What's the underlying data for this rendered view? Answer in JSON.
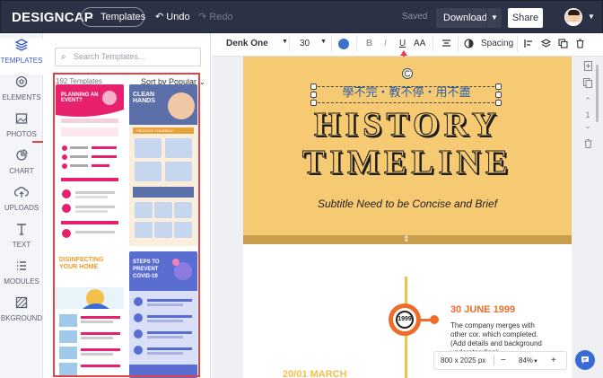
{
  "topbar": {
    "logo_design": "DESIGN",
    "logo_cap": "CAP",
    "templates_label": "Templates",
    "undo_label": "Undo",
    "redo_label": "Redo",
    "saved_label": "Saved",
    "download_label": "Download",
    "share_label": "Share"
  },
  "sidebar": {
    "items": [
      {
        "label": "TEMPLATES",
        "icon": "layers-icon"
      },
      {
        "label": "ELEMENTS",
        "icon": "elements-icon"
      },
      {
        "label": "PHOTOS",
        "icon": "photo-icon"
      },
      {
        "label": "CHART",
        "icon": "pie-chart-icon"
      },
      {
        "label": "UPLOADS",
        "icon": "upload-icon"
      },
      {
        "label": "TEXT",
        "icon": "text-icon"
      },
      {
        "label": "MODULES",
        "icon": "modules-icon"
      },
      {
        "label": "BKGROUND",
        "icon": "background-icon"
      }
    ]
  },
  "panel": {
    "search_placeholder": "Search Templates...",
    "count": "192 Templates",
    "sort_label": "Sort by Popular",
    "thumbs": [
      {
        "title": "PLANNING AN EVENT?"
      },
      {
        "title": "CLEAN HANDS",
        "sub": "PROTECT YOURSELF"
      },
      {
        "title": "DISINFECTING YOUR HOME"
      },
      {
        "title": "STEPS TO PREVENT COVID-19"
      }
    ]
  },
  "toolbar": {
    "font_name": "Denk One",
    "font_size": "30",
    "text_color": "#3b71c8",
    "bold": "B",
    "italic": "I",
    "underline": "U",
    "case": "AA",
    "spacing_label": "Spacing"
  },
  "canvas": {
    "chinese_text": "學不完・教不停・用不盡",
    "title_line1": "HISTORY",
    "title_line2": "TIMELINE",
    "subtitle": "Subtitle  Need to be Concise and Brief",
    "timeline_year": "1999",
    "timeline_date": "30 JUNE 1999",
    "timeline_desc": "The company merges with other cor. which completed. (Add details and background understanding)",
    "timeline_date2": "20/01 MARCH"
  },
  "rail": {
    "page_number": "1"
  },
  "zoom": {
    "size": "800 x 2025 px",
    "percent": "84%"
  },
  "colors": {
    "topbar": "#2c3245",
    "accent": "#3a57c5",
    "header_yellow": "#f6ca73",
    "highlight_red": "#e3404c",
    "timeline_orange": "#ef6b2a"
  }
}
